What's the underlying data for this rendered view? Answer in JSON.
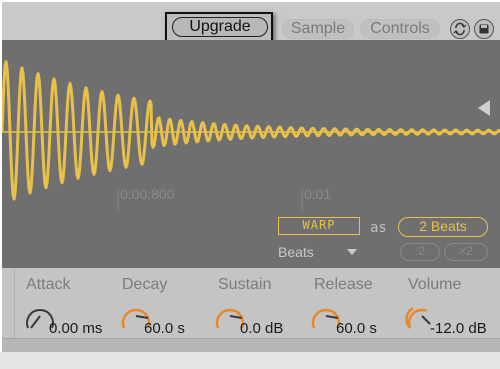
{
  "header": {
    "upgrade_label": "Upgrade",
    "tabs": [
      {
        "label": "Sample"
      },
      {
        "label": "Controls"
      }
    ]
  },
  "waveform": {
    "ruler_marks": [
      "0:00:800",
      "0:01"
    ],
    "warp_label": "WARP",
    "as_label": "as",
    "beats_value": "2 Beats",
    "mode_select": "Beats",
    "halve_label": ":2",
    "double_label": "×2",
    "wave_color": "#e8c14a"
  },
  "envelope": {
    "knobs": [
      {
        "label": "Attack",
        "value": "0.00 ms"
      },
      {
        "label": "Decay",
        "value": "60.0 s"
      },
      {
        "label": "Sustain",
        "value": "0.0 dB"
      },
      {
        "label": "Release",
        "value": "60.0 s"
      },
      {
        "label": "Volume",
        "value": "-12.0 dB"
      }
    ],
    "accent": "#e8882a"
  }
}
